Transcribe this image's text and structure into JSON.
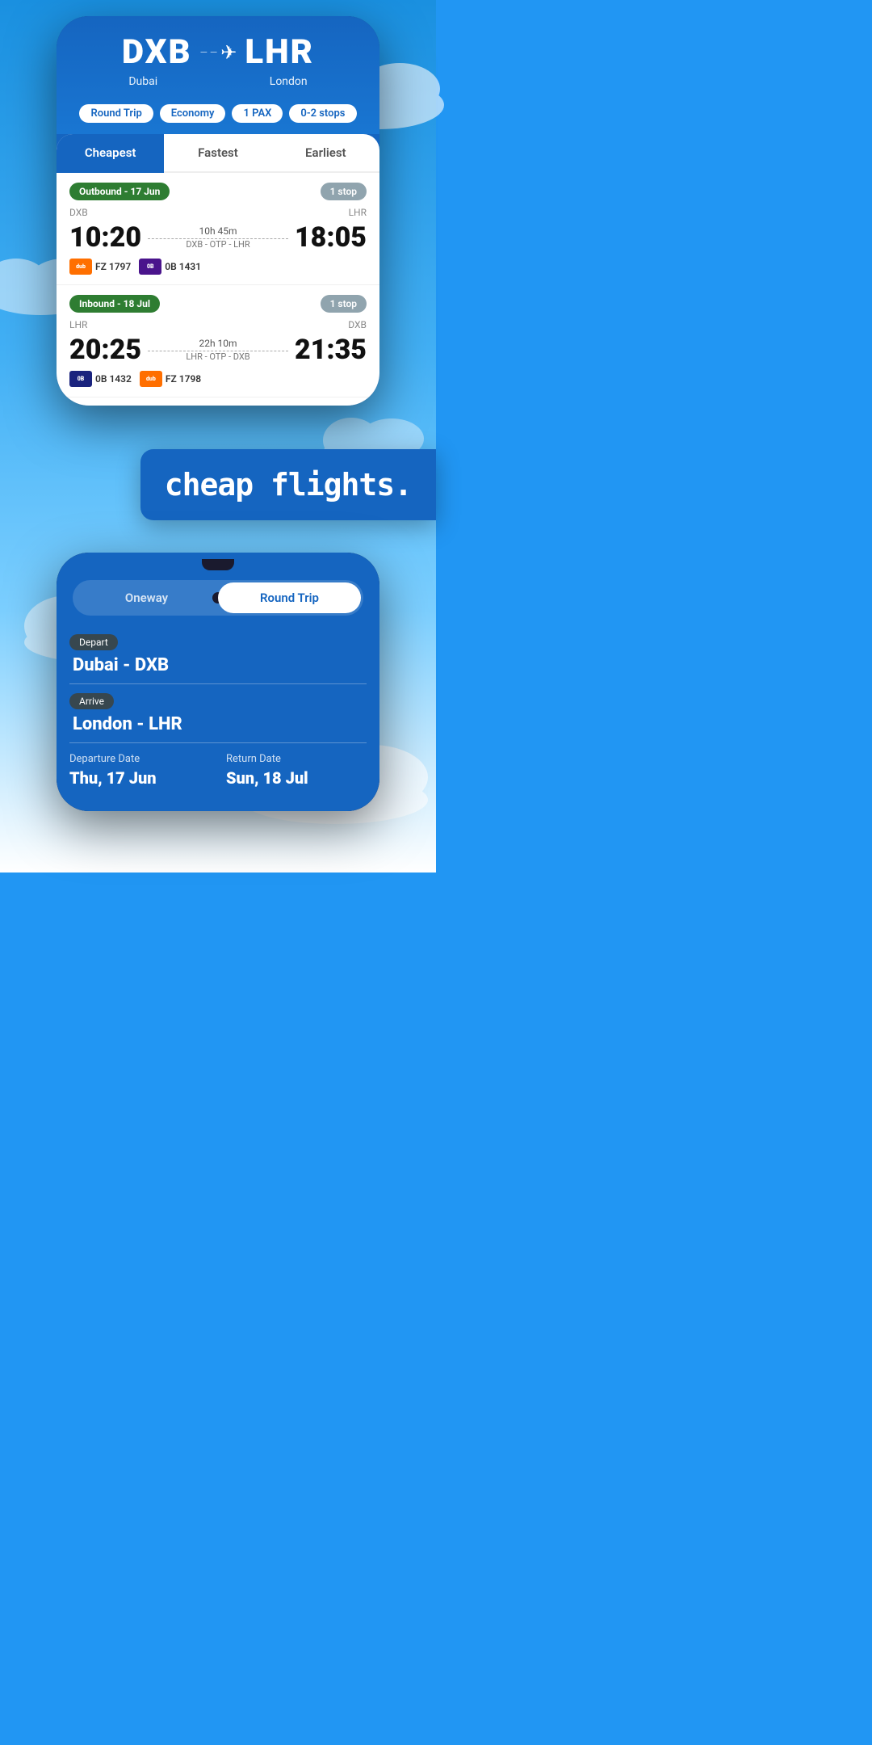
{
  "background": {
    "color": "#2196F3"
  },
  "phone1": {
    "origin_code": "DXB",
    "origin_city": "Dubai",
    "destination_code": "LHR",
    "destination_city": "London",
    "filters": {
      "trip_type": "Round Trip",
      "cabin": "Economy",
      "pax": "1 PAX",
      "stops": "0-2 stops"
    },
    "tabs": [
      {
        "label": "Cheapest",
        "active": true
      },
      {
        "label": "Fastest",
        "active": false
      },
      {
        "label": "Earliest",
        "active": false
      }
    ],
    "outbound": {
      "segment_label": "Outbound - 17 Jun",
      "stop_badge": "1 stop",
      "from": "DXB",
      "to": "LHR",
      "depart_time": "10:20",
      "arrive_time": "18:05",
      "duration": "10h 45m",
      "route": "DXB - OTP - LHR",
      "airlines": [
        {
          "logo_text": "dubai",
          "color": "orange",
          "flight": "FZ 1797"
        },
        {
          "logo_text": "0B",
          "color": "purple",
          "flight": "0B 1431"
        }
      ]
    },
    "inbound": {
      "segment_label": "Inbound - 18 Jul",
      "stop_badge": "1 stop",
      "from": "LHR",
      "to": "DXB",
      "depart_time": "20:25",
      "arrive_time": "21:35",
      "duration": "22h 10m",
      "route": "LHR - OTP - DXB",
      "airlines": [
        {
          "logo_text": "0B",
          "color": "blue",
          "flight": "0B 1432"
        },
        {
          "logo_text": "dubai",
          "color": "orange",
          "flight": "FZ 1798"
        }
      ]
    }
  },
  "banner": {
    "text": "cheap flights."
  },
  "phone2": {
    "trip_options": [
      {
        "label": "Oneway",
        "active": false
      },
      {
        "label": "Round Trip",
        "active": true
      }
    ],
    "depart_label": "Depart",
    "depart_value": "Dubai - DXB",
    "arrive_label": "Arrive",
    "arrive_value": "London - LHR",
    "departure_date_label": "Departure Date",
    "departure_date_value": "Thu, 17 Jun",
    "return_date_label": "Return Date",
    "return_date_value": "Sun, 18 Jul"
  }
}
